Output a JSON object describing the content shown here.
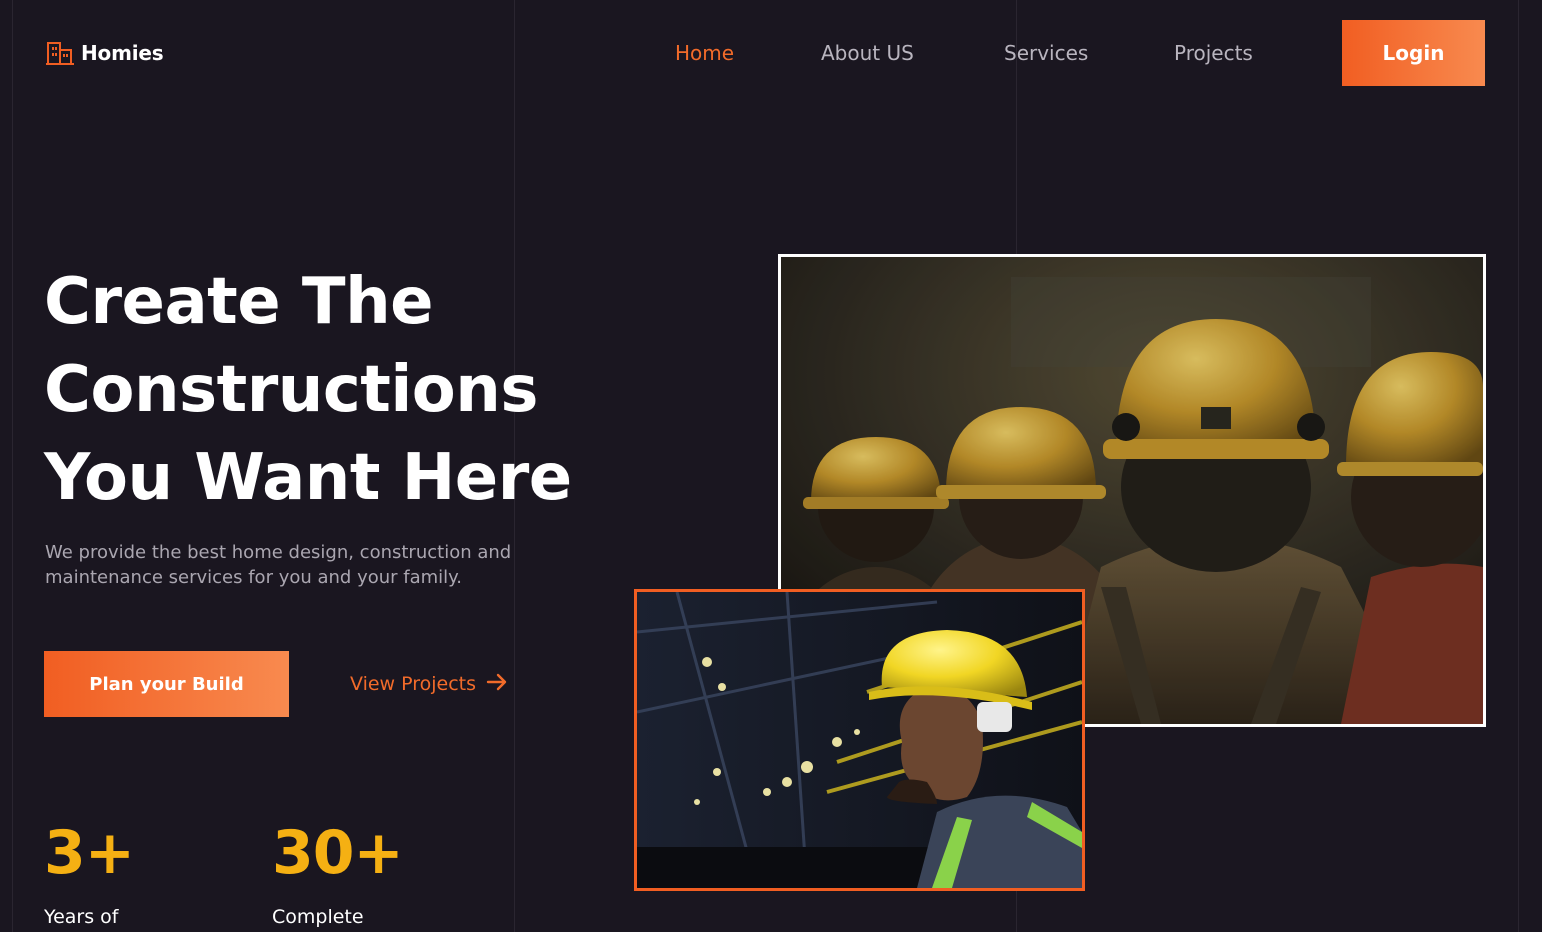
{
  "brand": {
    "name": "Homies",
    "icon": "building-icon",
    "accent_color": "#f15e22"
  },
  "nav": {
    "items": [
      {
        "label": "Home",
        "active": true
      },
      {
        "label": "About US",
        "active": false
      },
      {
        "label": "Services",
        "active": false
      },
      {
        "label": "Projects",
        "active": false
      }
    ],
    "login_label": "Login"
  },
  "hero": {
    "title_lines": [
      "Create The",
      "Constructions",
      "You Want Here"
    ],
    "subtitle_lines": [
      "We provide the best home design, construction and",
      "maintenance services for you and your family."
    ],
    "primary_cta": "Plan your Build",
    "secondary_cta": "View Projects",
    "secondary_cta_icon": "arrow-right-icon"
  },
  "stats": [
    {
      "value": "3+",
      "label": "Years of"
    },
    {
      "value": "30+",
      "label": "Complete"
    }
  ],
  "images": {
    "main": {
      "subject": "construction workers in yellow hard hats"
    },
    "secondary": {
      "subject": "worker in yellow hard hat and safety vest"
    }
  },
  "colors": {
    "background": "#1a1620",
    "accent": "#f15e22",
    "stat_color": "#f5b013",
    "muted_text": "#aaa6b0"
  }
}
